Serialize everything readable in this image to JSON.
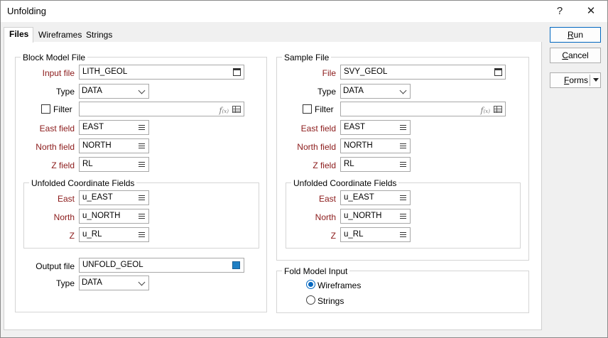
{
  "window": {
    "title": "Unfolding",
    "help_glyph": "?",
    "close_glyph": "✕"
  },
  "tabs": [
    {
      "label": "Files",
      "active": true
    },
    {
      "label": "Wireframes",
      "active": false
    },
    {
      "label": "Strings",
      "active": false
    }
  ],
  "block_model": {
    "group_title": "Block Model File",
    "input_file": {
      "label": "Input file",
      "value": "LITH_GEOL"
    },
    "type": {
      "label": "Type",
      "value": "DATA"
    },
    "filter": {
      "label": "Filter",
      "checked": false,
      "value": ""
    },
    "east": {
      "label": "East field",
      "value": "EAST"
    },
    "north": {
      "label": "North field",
      "value": "NORTH"
    },
    "z": {
      "label": "Z field",
      "value": "RL"
    },
    "unfolded": {
      "title": "Unfolded Coordinate Fields",
      "east": {
        "label": "East",
        "value": "u_EAST"
      },
      "north": {
        "label": "North",
        "value": "u_NORTH"
      },
      "z": {
        "label": "Z",
        "value": "u_RL"
      }
    },
    "output_file": {
      "label": "Output file",
      "value": "UNFOLD_GEOL"
    },
    "output_type": {
      "label": "Type",
      "value": "DATA"
    }
  },
  "sample": {
    "group_title": "Sample File",
    "file": {
      "label": "File",
      "value": "SVY_GEOL"
    },
    "type": {
      "label": "Type",
      "value": "DATA"
    },
    "filter": {
      "label": "Filter",
      "checked": false,
      "value": ""
    },
    "east": {
      "label": "East field",
      "value": "EAST"
    },
    "north": {
      "label": "North field",
      "value": "NORTH"
    },
    "z": {
      "label": "Z field",
      "value": "RL"
    },
    "unfolded": {
      "title": "Unfolded Coordinate Fields",
      "east": {
        "label": "East",
        "value": "u_EAST"
      },
      "north": {
        "label": "North",
        "value": "u_NORTH"
      },
      "z": {
        "label": "Z",
        "value": "u_RL"
      }
    }
  },
  "fold_model": {
    "group_title": "Fold Model Input",
    "options": [
      {
        "label": "Wireframes",
        "selected": true
      },
      {
        "label": "Strings",
        "selected": false
      }
    ]
  },
  "buttons": {
    "run_pre": "",
    "run_ul": "R",
    "run_post": "un",
    "cancel_pre": "",
    "cancel_ul": "C",
    "cancel_post": "ancel",
    "forms_pre": "",
    "forms_ul": "F",
    "forms_post": "orms"
  },
  "colors": {
    "required_label": "#8b1a1a",
    "accent": "#0067c0",
    "swatch": "#1f7fc4"
  }
}
